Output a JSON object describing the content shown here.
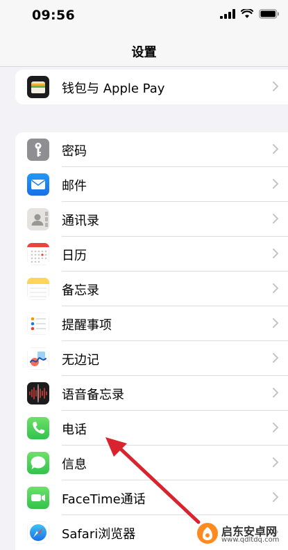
{
  "status_bar": {
    "time": "09:56"
  },
  "nav": {
    "title": "设置"
  },
  "wallet_group": [
    {
      "label": "钱包与 Apple Pay",
      "icon": "wallet-icon"
    }
  ],
  "main_group": [
    {
      "label": "密码",
      "icon": "key-icon"
    },
    {
      "label": "邮件",
      "icon": "mail-icon"
    },
    {
      "label": "通讯录",
      "icon": "contacts-icon"
    },
    {
      "label": "日历",
      "icon": "calendar-icon"
    },
    {
      "label": "备忘录",
      "icon": "notes-icon"
    },
    {
      "label": "提醒事项",
      "icon": "reminders-icon"
    },
    {
      "label": "无边记",
      "icon": "freeform-icon"
    },
    {
      "label": "语音备忘录",
      "icon": "voice-memos-icon"
    },
    {
      "label": "电话",
      "icon": "phone-icon"
    },
    {
      "label": "信息",
      "icon": "messages-icon"
    },
    {
      "label": "FaceTime通话",
      "icon": "facetime-icon"
    },
    {
      "label": "Safari浏览器",
      "icon": "safari-icon"
    }
  ],
  "watermark": {
    "name": "启东安卓网",
    "url": "www.qdltdq.com"
  },
  "colors": {
    "background": "#f2f2f7",
    "annotation_arrow": "#d9232e"
  }
}
